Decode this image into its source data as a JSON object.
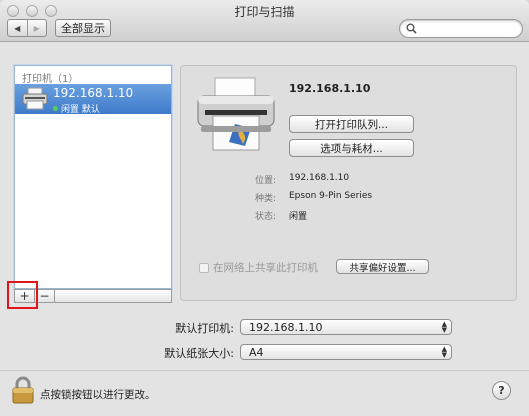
{
  "window": {
    "title": "打印与扫描"
  },
  "toolbar": {
    "back_glyph": "◀",
    "forward_glyph": "▶",
    "show_all_label": "全部显示",
    "search_placeholder": "",
    "search_icon": "magnifier-icon"
  },
  "printer_list": {
    "header": "打印机（1）",
    "items": [
      {
        "name": "192.168.1.10",
        "status": "闲置  默认",
        "status_color": "#53d04c"
      }
    ],
    "add_glyph": "+",
    "remove_glyph": "−"
  },
  "detail": {
    "printer_name": "192.168.1.10",
    "open_queue_label": "打开打印队列...",
    "options_label": "选项与耗材...",
    "info": [
      {
        "label": "位置:",
        "value": "192.168.1.10"
      },
      {
        "label": "种类:",
        "value": "Epson 9-Pin Series"
      },
      {
        "label": "状态:",
        "value": "闲置"
      }
    ],
    "share_label": "在网络上共享此打印机",
    "share_checked": false,
    "share_prefs_label": "共享偏好设置..."
  },
  "defaults": {
    "printer_label": "默认打印机:",
    "printer_value": "192.168.1.10",
    "paper_label": "默认纸张大小:",
    "paper_value": "A4"
  },
  "footer": {
    "lock_text": "点按锁按钮以进行更改。",
    "help_glyph": "?"
  },
  "colors": {
    "selection": "#3f7bcb",
    "highlight_box": "#e0141a"
  }
}
